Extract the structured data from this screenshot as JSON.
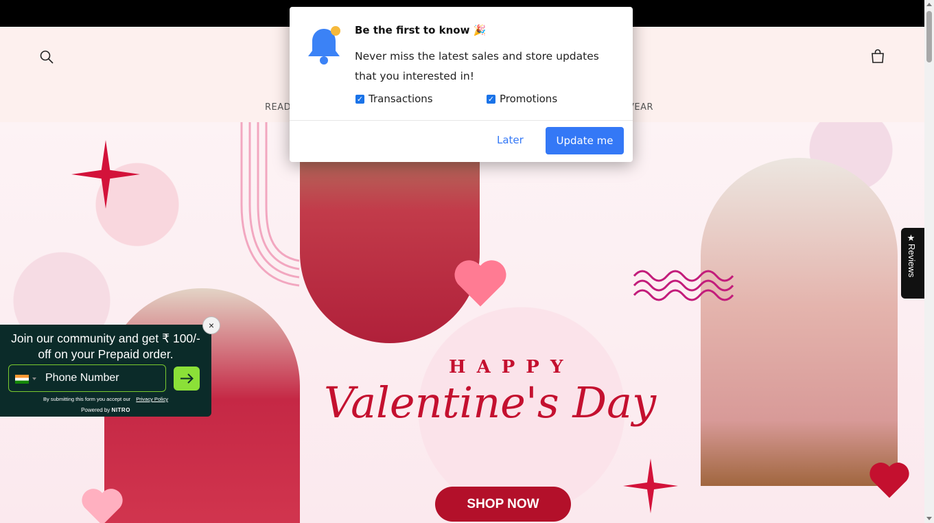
{
  "header": {
    "nav_left_fragment": "READ",
    "nav_right_fragment": "VEAR"
  },
  "hero": {
    "headline_top": "HAPPY",
    "headline_script": "Valentine's Day",
    "cta": "SHOP NOW"
  },
  "reviews_tab": {
    "label": "★Reviews"
  },
  "push_prompt": {
    "title": "Be the first to know 🎉",
    "message": "Never miss the latest sales and store updates that you interested in!",
    "options": [
      {
        "label": "Transactions",
        "checked": true
      },
      {
        "label": "Promotions",
        "checked": true
      }
    ],
    "later_label": "Later",
    "confirm_label": "Update me",
    "accent_color": "#3478f6"
  },
  "phone_widget": {
    "close_label": "×",
    "headline": "Join our community and get ₹ 100/- off on your Prepaid order.",
    "phone_placeholder": "Phone Number",
    "disclaimer": "By submitting this form you accept our",
    "privacy_link": "Privacy Policy",
    "powered_by": "Powered by",
    "brand": "NITRO",
    "accent_color": "#8be038"
  },
  "icons": {
    "search": "search-icon",
    "cart": "bag-icon",
    "bell": "bell-icon",
    "submit": "arrow-right-icon"
  }
}
